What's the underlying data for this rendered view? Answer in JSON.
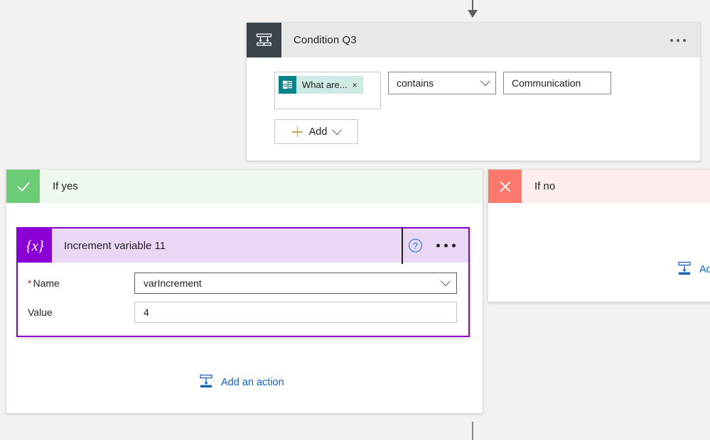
{
  "canvas": {
    "background_color": "#f3f2f1",
    "connector_color": "#605e5c"
  },
  "condition_card": {
    "title": "Condition Q3",
    "icon": "condition-branch-icon",
    "overflow_menu": "ellipsis-icon",
    "expression": {
      "token": {
        "label": "What are...",
        "icon": "microsoft-forms-icon",
        "icon_color": "#038387",
        "chip_color": "#cfe9e5",
        "remove": "×"
      },
      "operator": {
        "value": "contains",
        "chevron": "chevron-down-icon"
      },
      "value": "Communication"
    },
    "add_button": {
      "label": "Add",
      "plus": "plus-icon",
      "chevron": "chevron-down-icon"
    }
  },
  "branch_yes": {
    "label": "If yes",
    "badge": "checkmark-icon",
    "badge_color": "#6dcc77",
    "header_color": "#eef8ef",
    "add_action": {
      "label": "Add an action",
      "icon": "add-action-icon",
      "color": "#0f63c9"
    },
    "action": {
      "title": "Increment variable 11",
      "icon": "{x}",
      "icon_name": "variable-icon",
      "accent_color": "#8a00d4",
      "header_color": "#ead6f5",
      "help": "?",
      "overflow_menu": "ellipsis-icon",
      "fields": [
        {
          "label": "Name",
          "required": true,
          "value": "varIncrement",
          "type": "dropdown"
        },
        {
          "label": "Value",
          "required": false,
          "value": "4",
          "type": "text"
        }
      ]
    }
  },
  "branch_no": {
    "label": "If no",
    "badge": "close-x-icon",
    "badge_color": "#f97a6d",
    "header_color": "#fdeeed",
    "add_action": {
      "label": "Ad",
      "icon": "add-action-icon",
      "color": "#0f63c9"
    }
  }
}
